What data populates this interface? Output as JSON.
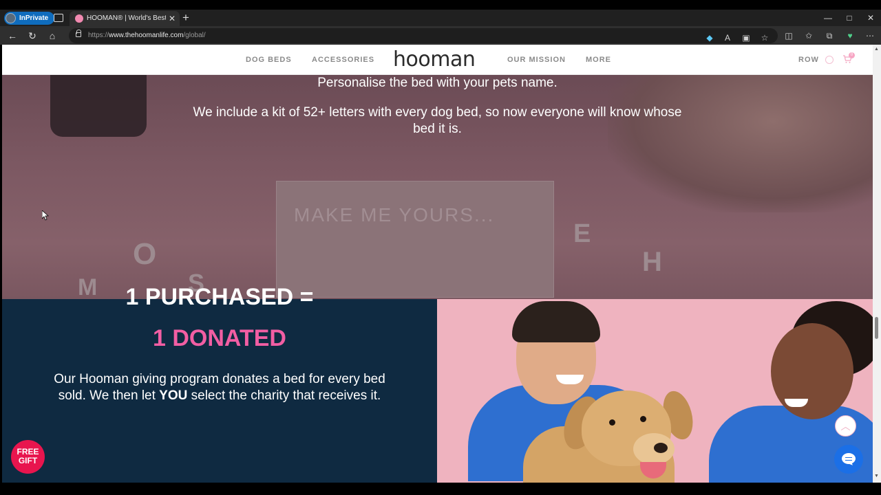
{
  "browser": {
    "inprivate_label": "InPrivate",
    "tab_title": "HOOMAN® | World's Best Human",
    "url_prefix": "https://",
    "url_host": "www.thehoomanlife.com",
    "url_path": "/global/",
    "window_controls": [
      "—",
      "□",
      "✕"
    ]
  },
  "header": {
    "nav_left": [
      "DOG BEDS",
      "ACCESSORIES"
    ],
    "logo": "hooman",
    "nav_right": [
      "OUR MISSION",
      "MORE"
    ],
    "region": "ROW",
    "cart_count": "0"
  },
  "hero": {
    "line1": "Personalise the bed with your pets name.",
    "line2": "We include a kit of 52+ letters with every dog bed, so now everyone will know whose",
    "line3": "bed it is.",
    "card_text": "MAKE ME YOURS..."
  },
  "promo": {
    "heading1": "1 PURCHASED =",
    "heading2": "1 DONATED",
    "body_part1": "Our Hooman giving program donates a bed for every bed sold. We then let ",
    "body_emphasis": "YOU",
    "body_part2": " select the charity that receives it."
  },
  "widgets": {
    "free_gift_line1": "FREE",
    "free_gift_line2": "GIFT"
  },
  "colors": {
    "navy_panel": "#0f2a41",
    "pink_accent": "#f25ea3",
    "free_gift_red": "#e8154e",
    "chat_blue": "#1b6fe6"
  }
}
